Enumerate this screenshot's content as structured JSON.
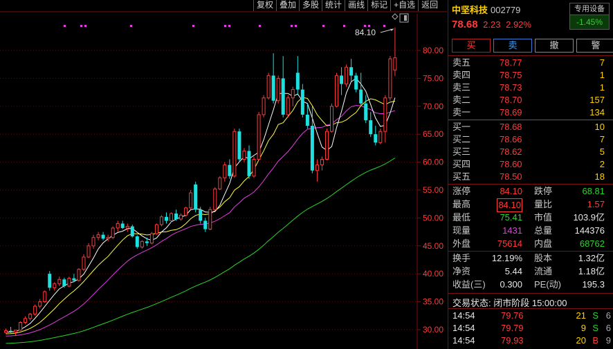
{
  "toolbar": [
    "复权",
    "叠加",
    "多股",
    "统计",
    "画线",
    "标记",
    "+自选",
    "返回"
  ],
  "header": {
    "name": "中坚科技",
    "code": "002779",
    "price": "78.68",
    "change": "2.23",
    "change_pct": "2.92%",
    "device_label": "专用设备",
    "device_change": "-1.45%"
  },
  "buttons": {
    "buy": "买",
    "sell": "卖",
    "cancel": "撤",
    "alert": "警"
  },
  "asks": [
    {
      "label": "卖五",
      "price": "78.77",
      "vol": "7"
    },
    {
      "label": "卖四",
      "price": "78.75",
      "vol": "1"
    },
    {
      "label": "卖三",
      "price": "78.73",
      "vol": "1"
    },
    {
      "label": "卖二",
      "price": "78.70",
      "vol": "157"
    },
    {
      "label": "卖一",
      "price": "78.69",
      "vol": "134"
    }
  ],
  "bids": [
    {
      "label": "买一",
      "price": "78.68",
      "vol": "10"
    },
    {
      "label": "买二",
      "price": "78.66",
      "vol": "7"
    },
    {
      "label": "买三",
      "price": "78.62",
      "vol": "5"
    },
    {
      "label": "买四",
      "price": "78.60",
      "vol": "2"
    },
    {
      "label": "买五",
      "price": "78.50",
      "vol": "18"
    }
  ],
  "stats1": [
    {
      "k1": "涨停",
      "v1": "84.10",
      "c1": "red",
      "k2": "跌停",
      "v2": "68.81",
      "c2": "grn"
    },
    {
      "k1": "最高",
      "v1": "84.10",
      "c1": "red",
      "k2": "量比",
      "v2": "1.57",
      "c2": "red"
    },
    {
      "k1": "最低",
      "v1": "75.41",
      "c1": "grn",
      "k2": "市值",
      "v2": "103.9亿",
      "c2": "wht"
    },
    {
      "k1": "现量",
      "v1": "1431",
      "c1": "mag",
      "k2": "总量",
      "v2": "144376",
      "c2": "wht"
    },
    {
      "k1": "外盘",
      "v1": "75614",
      "c1": "red",
      "k2": "内盘",
      "v2": "68762",
      "c2": "grn"
    }
  ],
  "stats2": [
    {
      "k1": "换手",
      "v1": "12.19%",
      "k2": "股本",
      "v2": "1.32亿"
    },
    {
      "k1": "净资",
      "v1": "5.44",
      "k2": "流通",
      "v2": "1.18亿"
    },
    {
      "k1": "收益(三)",
      "v1": "0.300",
      "k2": "PE(动)",
      "v2": "195.3"
    }
  ],
  "status": "交易状态: 闭市阶段 15:00:00",
  "ticks": [
    {
      "time": "14:54",
      "price": "79.76",
      "vol": "21",
      "dir": "S",
      "n": "6"
    },
    {
      "time": "14:54",
      "price": "79.79",
      "vol": "9",
      "dir": "S",
      "n": "6"
    },
    {
      "time": "14:54",
      "price": "79.93",
      "vol": "20",
      "dir": "B",
      "n": "9"
    }
  ],
  "chart_data": {
    "type": "candlestick",
    "ylim": [
      28,
      85
    ],
    "yticks": [
      "30.00",
      "35.00",
      "40.00",
      "45.00",
      "50.00",
      "55.00",
      "60.00",
      "65.00",
      "70.00",
      "75.00",
      "80.00"
    ],
    "annotation": "84.10",
    "colors": {
      "up": "#ff3b3b",
      "down": "#1ee0e0",
      "ma5": "#ffffff",
      "ma10": "#ffff40",
      "ma20": "#e040e0",
      "ma60": "#28d728"
    },
    "candles": [
      [
        29.5,
        30.2,
        29.2,
        29.8
      ],
      [
        29.8,
        30.5,
        29.4,
        29.6
      ],
      [
        29.6,
        30.0,
        29.0,
        29.9
      ],
      [
        29.9,
        31.5,
        29.8,
        31.3
      ],
      [
        31.3,
        32.4,
        31.0,
        32.0
      ],
      [
        32.0,
        33.0,
        31.6,
        32.8
      ],
      [
        32.8,
        34.5,
        32.5,
        34.2
      ],
      [
        34.2,
        35.5,
        33.8,
        35.0
      ],
      [
        35.0,
        37.0,
        34.8,
        36.8
      ],
      [
        40.0,
        40.5,
        37.0,
        37.5
      ],
      [
        37.5,
        38.5,
        37.0,
        38.2
      ],
      [
        38.2,
        39.5,
        37.8,
        39.0
      ],
      [
        39.0,
        39.3,
        37.5,
        37.8
      ],
      [
        37.8,
        39.5,
        37.6,
        39.2
      ],
      [
        39.2,
        40.0,
        38.5,
        38.8
      ],
      [
        38.8,
        41.0,
        38.6,
        40.8
      ],
      [
        40.8,
        43.5,
        40.5,
        43.0
      ],
      [
        43.0,
        45.5,
        42.8,
        45.0
      ],
      [
        45.0,
        47.0,
        44.5,
        46.5
      ],
      [
        46.5,
        47.5,
        46.0,
        47.0
      ],
      [
        47.0,
        47.5,
        46.0,
        46.3
      ],
      [
        46.3,
        47.0,
        45.8,
        46.5
      ],
      [
        46.5,
        48.5,
        46.2,
        48.2
      ],
      [
        48.2,
        49.5,
        47.5,
        49.0
      ],
      [
        49.0,
        49.5,
        48.0,
        48.2
      ],
      [
        48.2,
        49.0,
        47.5,
        48.5
      ],
      [
        48.5,
        48.8,
        46.5,
        46.7
      ],
      [
        46.7,
        46.9,
        44.5,
        44.8
      ],
      [
        44.8,
        46.0,
        44.5,
        45.8
      ],
      [
        45.8,
        46.5,
        45.0,
        45.5
      ],
      [
        45.5,
        47.5,
        45.3,
        47.2
      ],
      [
        47.2,
        49.0,
        47.0,
        48.8
      ],
      [
        48.8,
        50.5,
        48.5,
        50.2
      ],
      [
        50.2,
        51.0,
        49.0,
        49.5
      ],
      [
        49.5,
        51.0,
        49.2,
        50.8
      ],
      [
        50.8,
        51.5,
        49.5,
        49.8
      ],
      [
        49.8,
        50.8,
        49.5,
        50.5
      ],
      [
        50.5,
        52.0,
        50.3,
        51.8
      ],
      [
        51.8,
        55.0,
        51.5,
        54.5
      ],
      [
        56.0,
        56.5,
        51.0,
        51.5
      ],
      [
        51.5,
        52.0,
        49.0,
        49.5
      ],
      [
        49.5,
        50.0,
        47.5,
        48.0
      ],
      [
        48.0,
        52.0,
        47.8,
        51.5
      ],
      [
        51.5,
        55.5,
        51.2,
        55.2
      ],
      [
        55.2,
        57.5,
        55.0,
        57.2
      ],
      [
        57.2,
        60.0,
        56.5,
        59.5
      ],
      [
        59.5,
        60.5,
        57.0,
        57.5
      ],
      [
        57.5,
        66.0,
        57.2,
        65.5
      ],
      [
        65.5,
        66.0,
        60.0,
        60.5
      ],
      [
        60.5,
        62.5,
        60.0,
        62.0
      ],
      [
        62.0,
        63.0,
        57.0,
        57.5
      ],
      [
        57.5,
        61.0,
        57.2,
        60.5
      ],
      [
        60.5,
        69.0,
        60.3,
        68.5
      ],
      [
        68.5,
        72.0,
        68.0,
        71.5
      ],
      [
        71.5,
        76.0,
        71.2,
        75.5
      ],
      [
        75.5,
        79.5,
        70.5,
        71.0
      ],
      [
        71.0,
        75.5,
        70.5,
        75.0
      ],
      [
        75.0,
        79.0,
        68.0,
        68.5
      ],
      [
        68.5,
        72.0,
        68.0,
        71.5
      ],
      [
        71.5,
        73.5,
        70.0,
        73.0
      ],
      [
        76.0,
        79.0,
        72.0,
        73.0
      ],
      [
        73.0,
        74.0,
        68.0,
        68.5
      ],
      [
        68.5,
        70.5,
        66.0,
        66.5
      ],
      [
        66.5,
        70.0,
        58.0,
        58.5
      ],
      [
        58.5,
        60.5,
        56.5,
        59.5
      ],
      [
        59.5,
        61.0,
        58.5,
        60.5
      ],
      [
        60.5,
        66.0,
        60.3,
        65.5
      ],
      [
        65.5,
        70.5,
        65.3,
        70.0
      ],
      [
        70.0,
        76.0,
        69.8,
        75.5
      ],
      [
        75.5,
        77.0,
        72.0,
        74.0
      ],
      [
        74.0,
        77.5,
        73.5,
        77.0
      ],
      [
        77.0,
        78.5,
        74.5,
        75.5
      ],
      [
        75.5,
        76.0,
        72.5,
        73.0
      ],
      [
        73.0,
        76.0,
        70.0,
        70.5
      ],
      [
        70.5,
        72.0,
        67.0,
        67.5
      ],
      [
        67.5,
        69.0,
        64.5,
        65.0
      ],
      [
        65.0,
        66.5,
        63.0,
        63.5
      ],
      [
        63.5,
        66.0,
        63.2,
        65.5
      ],
      [
        65.5,
        72.0,
        63.5,
        71.5
      ],
      [
        71.5,
        79.0,
        71.0,
        78.5
      ],
      [
        76.5,
        84.1,
        75.41,
        78.68
      ]
    ]
  }
}
